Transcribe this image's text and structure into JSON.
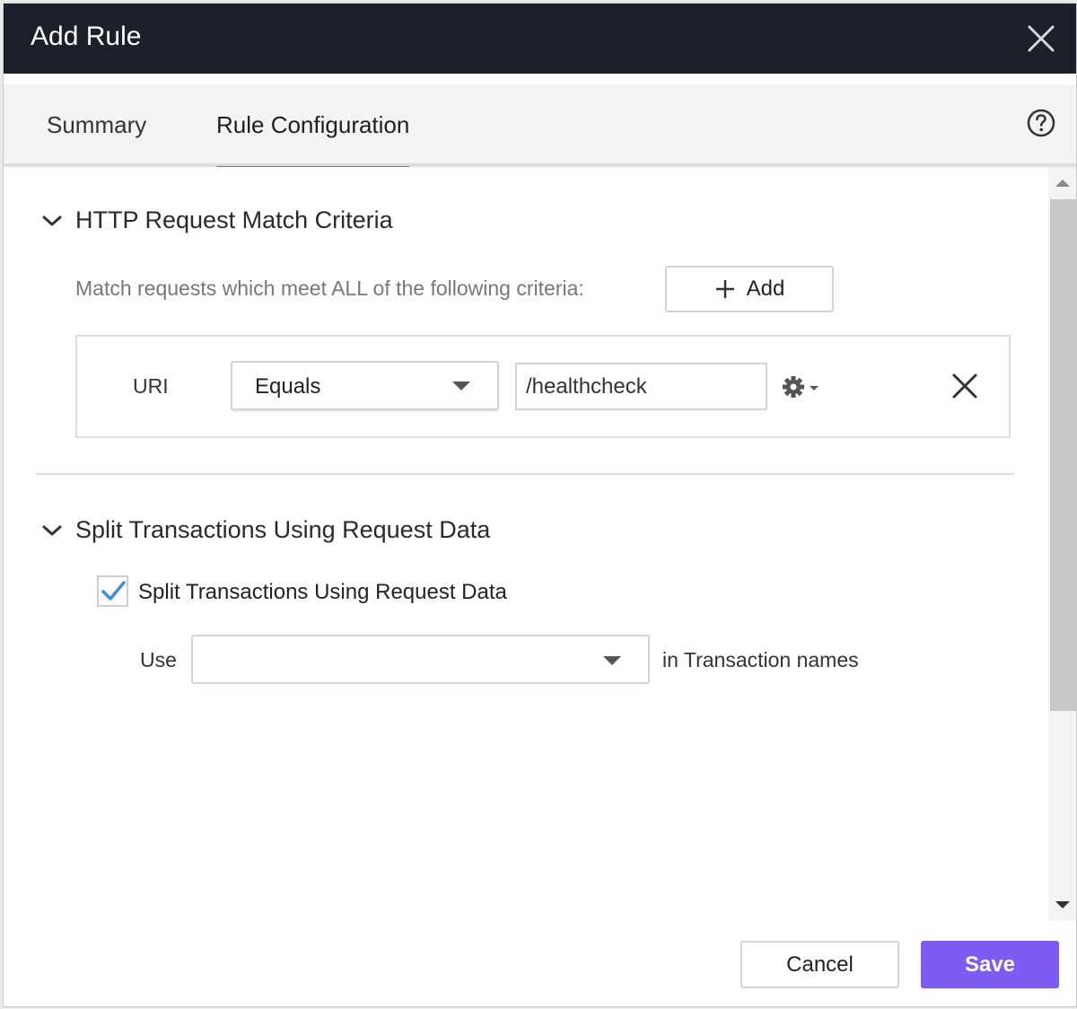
{
  "dialog": {
    "title": "Add Rule"
  },
  "tabs": [
    {
      "label": "Summary",
      "active": false
    },
    {
      "label": "Rule Configuration",
      "active": true
    }
  ],
  "match_section": {
    "title": "HTTP Request Match Criteria",
    "description": "Match requests which meet ALL of the following criteria:",
    "add_label": "Add",
    "criteria": [
      {
        "field": "URI",
        "operator": "Equals",
        "value": "/healthcheck"
      }
    ]
  },
  "split_section": {
    "title": "Split Transactions Using Request Data",
    "checkbox_label": "Split Transactions Using Request Data",
    "checked": true,
    "use_label": "Use",
    "use_value": "",
    "suffix_label": "in Transaction names"
  },
  "footer": {
    "cancel_label": "Cancel",
    "save_label": "Save"
  },
  "colors": {
    "accent": "#7c5cf3",
    "titlebar": "#1b202b",
    "check": "#3b8fe0"
  },
  "icons": [
    "close-icon",
    "help-icon",
    "chevron-down-icon",
    "plus-icon",
    "gear-icon",
    "remove-icon",
    "checkmark-icon"
  ]
}
